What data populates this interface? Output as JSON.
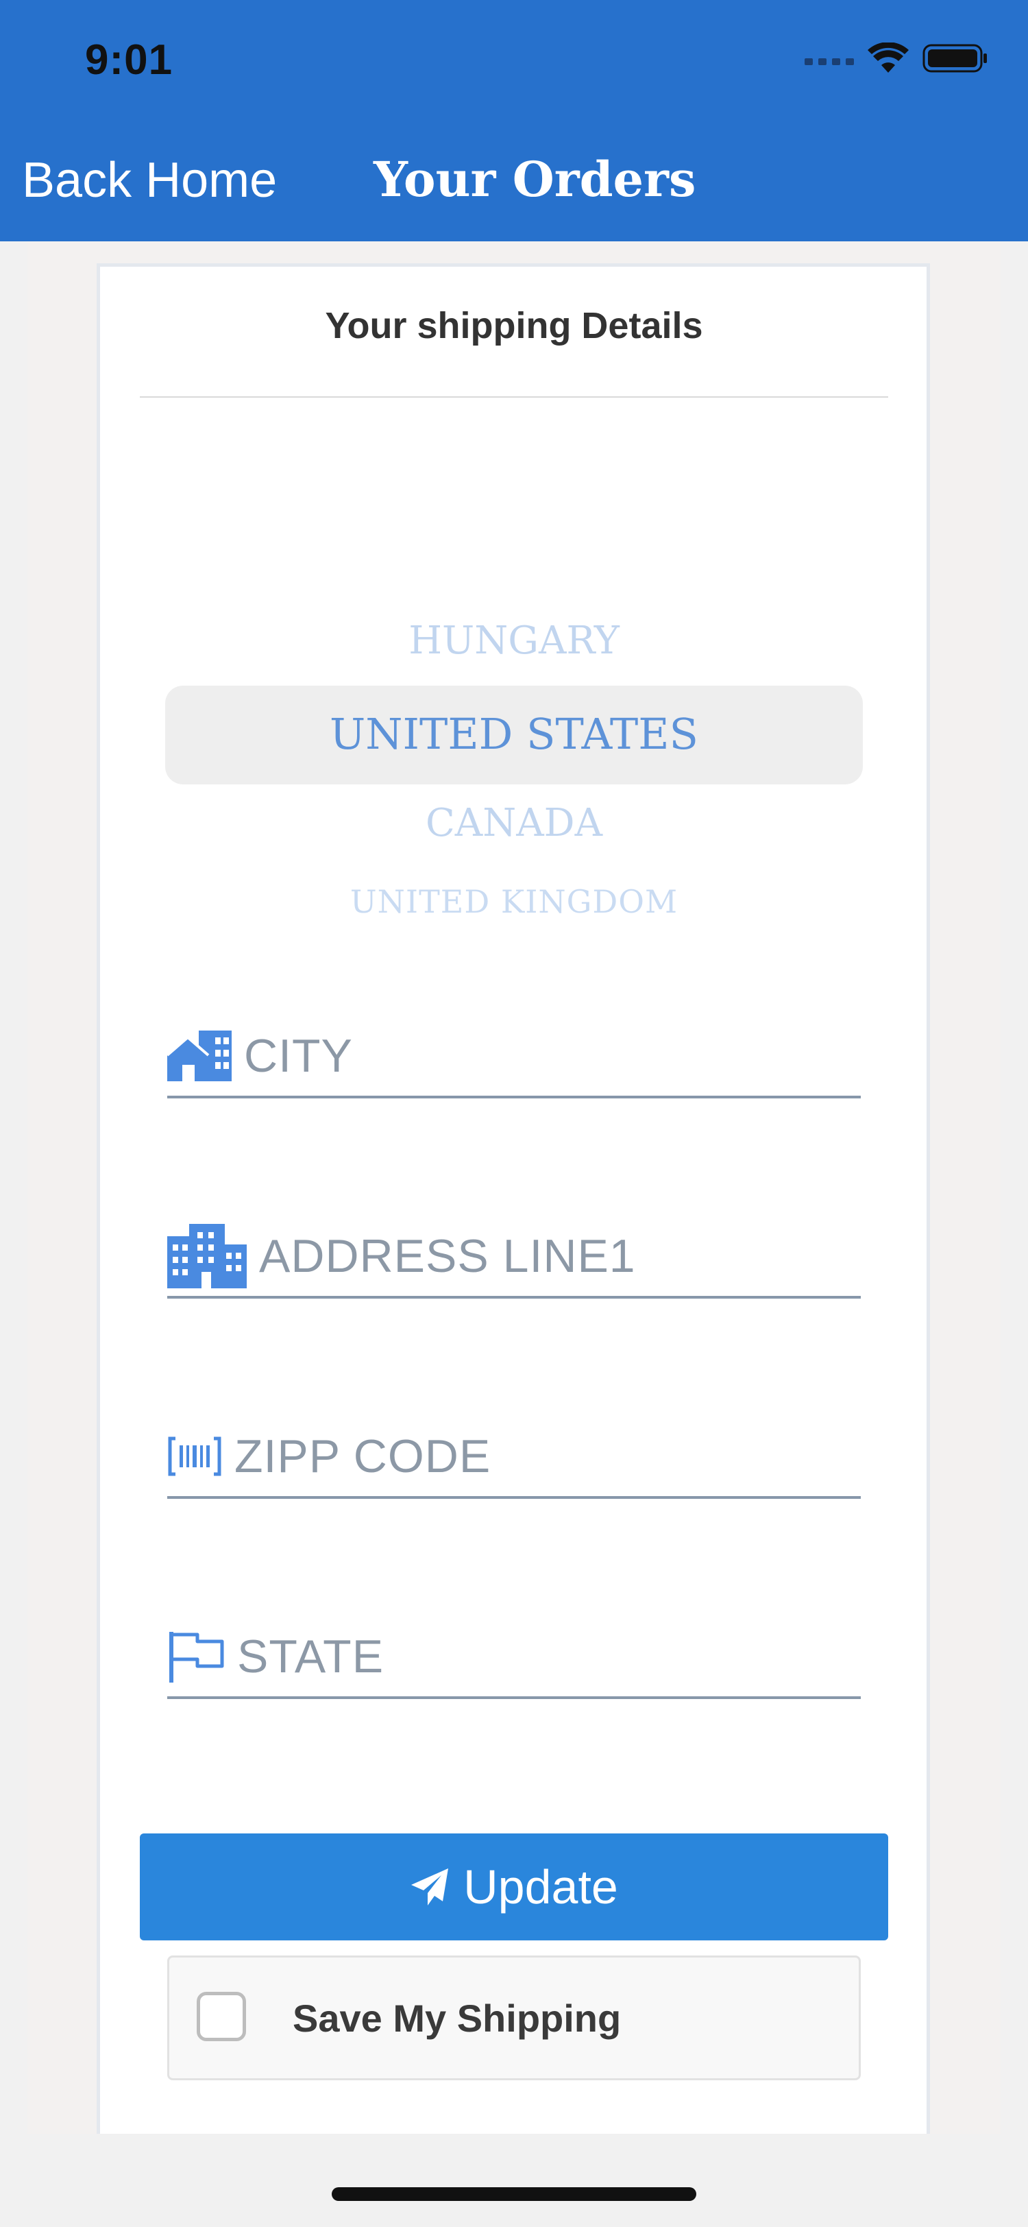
{
  "status_bar": {
    "time": "9:01"
  },
  "nav": {
    "back_label": "Back Home",
    "title": "Your Orders"
  },
  "card": {
    "title": "Your shipping Details"
  },
  "country_picker": {
    "items": [
      "HUNGARY",
      "UNITED STATES",
      "CANADA",
      "UNITED KINGDOM"
    ],
    "selected": "UNITED STATES"
  },
  "form": {
    "city": {
      "placeholder": "CITY",
      "icon": "city-icon"
    },
    "address": {
      "placeholder": "ADDRESS LINE1",
      "icon": "building-icon"
    },
    "zip": {
      "placeholder": "ZIPP CODE",
      "icon": "barcode-icon"
    },
    "state": {
      "placeholder": "STATE",
      "icon": "flag-icon"
    }
  },
  "update_button": {
    "label": "Update",
    "icon": "paper-plane-icon"
  },
  "save_shipping": {
    "label": "Save My Shipping",
    "checked": false
  },
  "colors": {
    "header": "#2771cc",
    "accent": "#2a86dc",
    "icon": "#4a8ae0"
  }
}
